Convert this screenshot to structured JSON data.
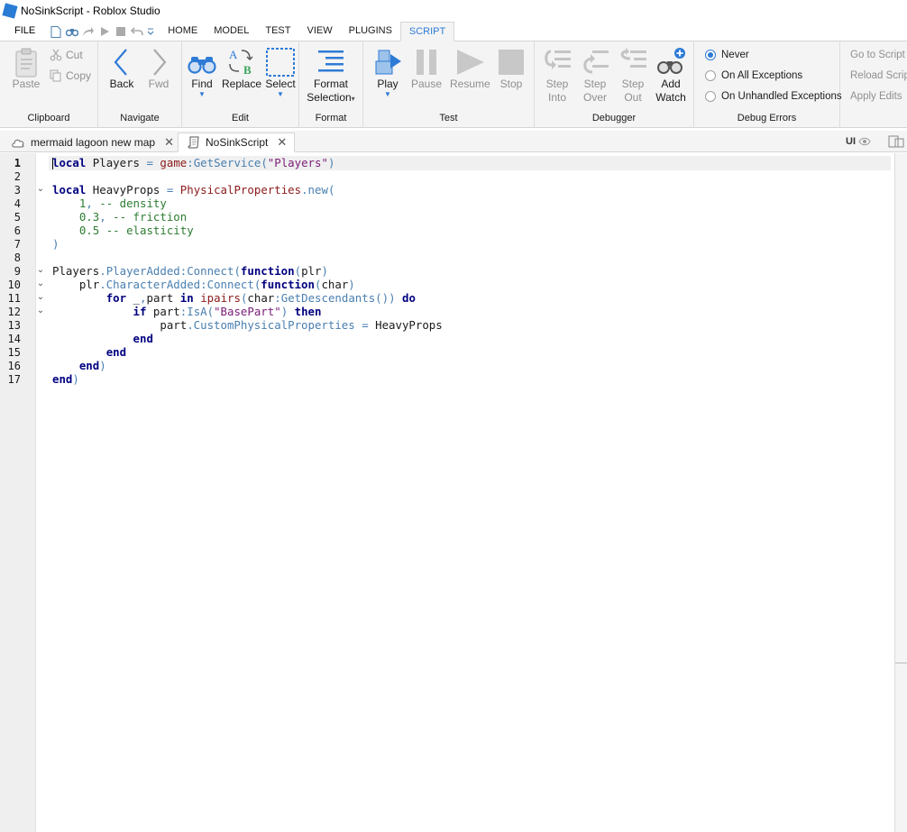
{
  "window": {
    "title": "NoSinkScript - Roblox Studio"
  },
  "menu": {
    "file": "FILE",
    "tabs": [
      "HOME",
      "MODEL",
      "TEST",
      "VIEW",
      "PLUGINS",
      "SCRIPT"
    ],
    "active_tab": "SCRIPT"
  },
  "ribbon": {
    "clipboard": {
      "label": "Clipboard",
      "paste": "Paste",
      "cut": "Cut",
      "copy": "Copy"
    },
    "navigate": {
      "label": "Navigate",
      "back": "Back",
      "fwd": "Fwd"
    },
    "edit": {
      "label": "Edit",
      "find": "Find",
      "replace": "Replace",
      "select": "Select"
    },
    "format": {
      "label": "Format",
      "format_selection_1": "Format",
      "format_selection_2": "Selection"
    },
    "test": {
      "label": "Test",
      "play": "Play",
      "pause": "Pause",
      "resume": "Resume",
      "stop": "Stop"
    },
    "debugger": {
      "label": "Debugger",
      "step_into_1": "Step",
      "step_into_2": "Into",
      "step_over_1": "Step",
      "step_over_2": "Over",
      "step_out_1": "Step",
      "step_out_2": "Out",
      "add_watch_1": "Add",
      "add_watch_2": "Watch"
    },
    "debug_errors": {
      "label": "Debug Errors",
      "options": [
        "Never",
        "On All Exceptions",
        "On Unhandled Exceptions"
      ],
      "selected": "Never"
    },
    "script_links": [
      "Go to Script E",
      "Reload Scrip",
      "Apply Edits"
    ]
  },
  "doc_tabs": [
    {
      "label": "mermaid lagoon new map",
      "active": false
    },
    {
      "label": "NoSinkScript",
      "active": true
    }
  ],
  "ui_toggle": "UI",
  "editor": {
    "line_numbers": [
      "1",
      "2",
      "3",
      "4",
      "5",
      "6",
      "7",
      "8",
      "9",
      "10",
      "11",
      "12",
      "13",
      "14",
      "15",
      "16",
      "17"
    ],
    "current_line": 1,
    "code_lines": [
      "local Players = game:GetService(\"Players\")",
      "",
      "local HeavyProps = PhysicalProperties.new(",
      "    1, -- density",
      "    0.3, -- friction",
      "    0.5 -- elasticity",
      ")",
      "",
      "Players.PlayerAdded:Connect(function(plr)",
      "    plr.CharacterAdded:Connect(function(char)",
      "        for _,part in ipairs(char:GetDescendants()) do",
      "            if part:IsA(\"BasePart\") then",
      "                part.CustomPhysicalProperties = HeavyProps",
      "            end",
      "        end",
      "    end)",
      "end)"
    ]
  }
}
